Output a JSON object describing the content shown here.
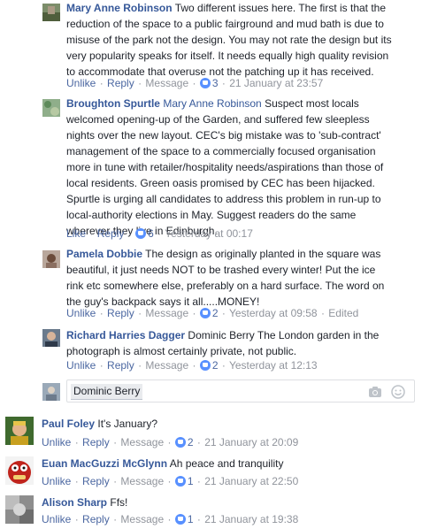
{
  "comments": [
    {
      "author": "Mary Anne Robinson",
      "lines": [
        "Two different issues here. The first is that the",
        "reduction of the space to a public fairground and mud bath is due to",
        "misuse of the park not the design. You may not rate the design but its",
        "very popularity speaks for itself. It needs equally high quality revision",
        "to accommodate that overuse not the patching up it has received."
      ],
      "like_label": "Unlike",
      "reply_label": "Reply",
      "message_label": "Message",
      "likes": "3",
      "time": "21 January at 23:57"
    },
    {
      "author": "Broughton Spurtle",
      "tag": "Mary Anne Robinson",
      "lines": [
        "Suspect most locals",
        "welcomed opening-up of the Garden, and suffered few sleepless",
        "nights over the new layout. CEC's big mistake was to 'sub-contract'",
        "management of the space to a commercially focused organisation",
        "more in tune with retailer/hospitality needs/aspirations than those of",
        "local residents. Green oasis promised by CEC has been hijacked.",
        "Spurtle is urging all candidates to address this problem in run-up to",
        "local-authority elections in May. Suggest readers do the same",
        "wherever they live in Edinburgh."
      ],
      "like_label": "Like",
      "reply_label": "Reply",
      "likes": "6",
      "time": "Yesterday at 00:17"
    },
    {
      "author": "Pamela Dobbie",
      "lines": [
        "The design as originally planted in the square was",
        "beautiful, it just needs NOT to be trashed every winter! Put the ice",
        "rink etc somewhere else, preferably on a hard surface. The word on",
        "the guy's backpack says it all.....MONEY!"
      ],
      "like_label": "Unlike",
      "reply_label": "Reply",
      "message_label": "Message",
      "likes": "2",
      "time": "Yesterday at 09:58",
      "edited": "Edited"
    },
    {
      "author": "Richard Harries Dagger",
      "lines": [
        "Dominic Berry The London garden in the",
        "photograph is almost certainly private, not public."
      ],
      "like_label": "Unlike",
      "reply_label": "Reply",
      "message_label": "Message",
      "likes": "2",
      "time": "Yesterday at 12:13"
    }
  ],
  "reply_box": {
    "mention": "Dominic Berry",
    "camera_icon": "camera-icon",
    "emoji_icon": "smiley-icon"
  },
  "top_comments": [
    {
      "author": "Paul Foley",
      "text": "It's January?",
      "like_label": "Unlike",
      "reply_label": "Reply",
      "message_label": "Message",
      "likes": "2",
      "time": "21 January at 20:09"
    },
    {
      "author": "Euan MacGuzzi McGlynn",
      "text": "Ah peace and tranquility",
      "like_label": "Unlike",
      "reply_label": "Reply",
      "message_label": "Message",
      "likes": "1",
      "time": "21 January at 22:50"
    },
    {
      "author": "Alison Sharp",
      "text": "Ffs!",
      "like_label": "Unlike",
      "reply_label": "Reply",
      "message_label": "Message",
      "likes": "1",
      "time": "21 January at 19:38"
    }
  ],
  "colors": {
    "link": "#365899",
    "meta": "#90949c",
    "like_badge": "#5890ff"
  }
}
